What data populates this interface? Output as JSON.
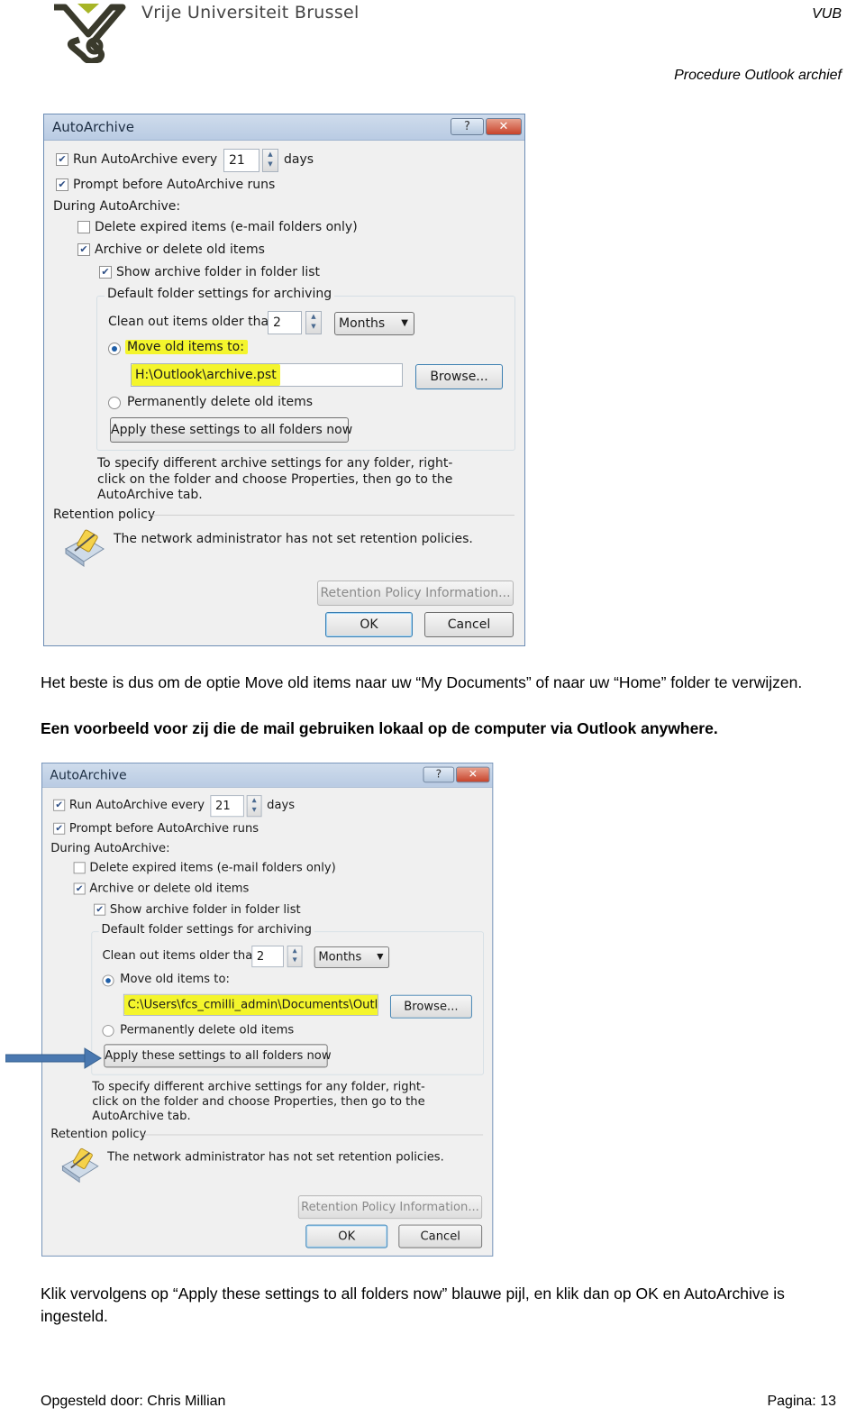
{
  "header": {
    "university": "Vrije Universiteit Brussel",
    "abbr": "VUB",
    "doc_title": "Procedure Outlook archief",
    "logo_colors": {
      "mark": "#3a3a2c",
      "accent": "#a7b526"
    }
  },
  "paragraph1": "Het beste is dus om de optie Move old items naar uw “My Documents” of naar uw “Home” folder te verwijzen.",
  "paragraph2": "Een voorbeeld voor zij die de mail gebruiken lokaal op de computer via Outlook anywhere.",
  "paragraph3": "Klik vervolgens op “Apply these settings to all folders now” blauwe pijl, en klik dan op OK en AutoArchive is ingesteld.",
  "footer": {
    "author": "Opgesteld door: Chris Millian",
    "page": "Pagina: 13"
  },
  "dialogs": [
    {
      "title": "AutoArchive",
      "help": "?",
      "close": "✕",
      "run_label": "Run AutoArchive every",
      "run_checked": true,
      "run_days": "21",
      "days_label": "days",
      "prompt_label": "Prompt before AutoArchive runs",
      "prompt_checked": true,
      "during_label": "During AutoArchive:",
      "delete_expired_label": "Delete expired items (e-mail folders only)",
      "delete_expired_checked": false,
      "archive_label": "Archive or delete old items",
      "archive_checked": true,
      "show_folder_label": "Show archive folder in folder list",
      "show_folder_checked": true,
      "group_label": "Default folder settings for archiving",
      "clean_label": "Clean out items older than",
      "clean_value": "2",
      "clean_unit": "Months",
      "move_label": "Move old items to:",
      "move_selected": true,
      "path": "H:\\Outlook\\archive.pst",
      "browse": "Browse...",
      "perm_delete_label": "Permanently delete old items",
      "apply": "Apply these settings to all folders now",
      "note": "To specify different archive settings for any folder, right-click on the folder and choose Properties, then go to the AutoArchive tab.",
      "retention_label": "Retention policy",
      "retention_text": "The network administrator has not set retention policies.",
      "retention_button": "Retention Policy Information...",
      "ok": "OK",
      "cancel": "Cancel",
      "highlight": "move-and-path"
    },
    {
      "title": "AutoArchive",
      "help": "?",
      "close": "✕",
      "run_label": "Run AutoArchive every",
      "run_checked": true,
      "run_days": "21",
      "days_label": "days",
      "prompt_label": "Prompt before AutoArchive runs",
      "prompt_checked": true,
      "during_label": "During AutoArchive:",
      "delete_expired_label": "Delete expired items (e-mail folders only)",
      "delete_expired_checked": false,
      "archive_label": "Archive or delete old items",
      "archive_checked": true,
      "show_folder_label": "Show archive folder in folder list",
      "show_folder_checked": true,
      "group_label": "Default folder settings for archiving",
      "clean_label": "Clean out items older than",
      "clean_value": "2",
      "clean_unit": "Months",
      "move_label": "Move old items to:",
      "move_selected": true,
      "path": "C:\\Users\\fcs_cmilli_admin\\Documents\\Outlook\\",
      "browse": "Browse...",
      "perm_delete_label": "Permanently delete old items",
      "apply": "Apply these settings to all folders now",
      "note": "To specify different archive settings for any folder, right-click on the folder and choose Properties, then go to the AutoArchive tab.",
      "retention_label": "Retention policy",
      "retention_text": "The network administrator has not set retention policies.",
      "retention_button": "Retention Policy Information...",
      "ok": "OK",
      "cancel": "Cancel",
      "highlight": "path",
      "arrow_color": "#4a78b0"
    }
  ]
}
